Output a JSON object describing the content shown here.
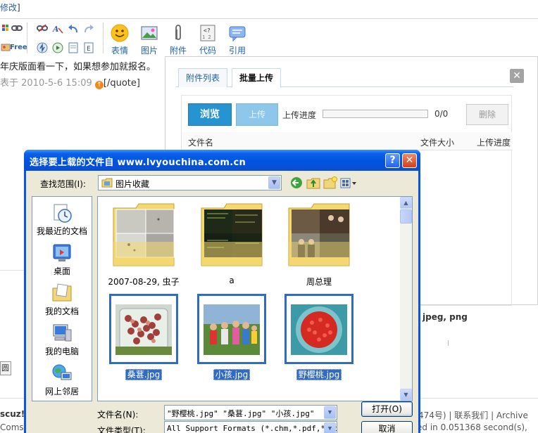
{
  "background": {
    "top_link": "修改",
    "toolbar": {
      "emoticon_label": "表情",
      "image_label": "图片",
      "attachment_label": "附件",
      "code_label": "代码",
      "quote_label": "引用",
      "free_label": "Free"
    },
    "quote_line1": "年庆版面看一下，如果想参加就报名。",
    "quote_line2_author": "表于 2010-5-6 15:09",
    "quote_line2_tail": "[/quote]",
    "formats_text": "jpeg, png",
    "left_box_text": "圆",
    "footer_left1": "scuz!",
    "footer_left2": "Comse",
    "footer_right1": "474号) | 联系我们 | Archive",
    "footer_right2": "ed in 0.051368 second(s),"
  },
  "upload_panel": {
    "tabs": [
      {
        "label": "附件列表",
        "active": false
      },
      {
        "label": "批量上传",
        "active": true
      }
    ],
    "close_symbol": "✕",
    "browse_label": "浏览",
    "upload_label": "上传",
    "progress_label": "上传进度",
    "progress_fraction": 0,
    "progress_count": "0/0",
    "delete_label": "删除",
    "columns": [
      "文件名",
      "文件大小",
      "上传进度"
    ]
  },
  "file_dialog": {
    "title": "选择要上载的文件自 www.lvyouchina.com.cn",
    "help_symbol": "?",
    "close_symbol": "✕",
    "lookin_label": "查找范围(I):",
    "lookin_value": "图片收藏",
    "places": [
      {
        "label": "我最近的文档",
        "icon": "recent-documents-icon"
      },
      {
        "label": "桌面",
        "icon": "desktop-icon"
      },
      {
        "label": "我的文档",
        "icon": "my-documents-icon"
      },
      {
        "label": "我的电脑",
        "icon": "my-computer-icon"
      },
      {
        "label": "网上邻居",
        "icon": "network-places-icon"
      }
    ],
    "items": [
      {
        "name": "2007-08-29, 虫子",
        "kind": "folder",
        "selected": false
      },
      {
        "name": "a",
        "kind": "folder",
        "selected": false
      },
      {
        "name": "周总理",
        "kind": "folder",
        "selected": false
      },
      {
        "name": "桑葚.jpg",
        "kind": "image",
        "selected": true
      },
      {
        "name": "小孩.jpg",
        "kind": "image",
        "selected": true
      },
      {
        "name": "野樱桃.jpg",
        "kind": "image",
        "selected": true
      }
    ],
    "filename_label": "文件名(N):",
    "filename_value": "\"野樱桃.jpg\" \"桑葚.jpg\" \"小孩.jpg\"",
    "filetype_label": "文件类型(T):",
    "filetype_value": "All Support Formats (*.chm,*.pdf,*.zi",
    "open_label": "打开(O)",
    "cancel_label": "取消"
  }
}
